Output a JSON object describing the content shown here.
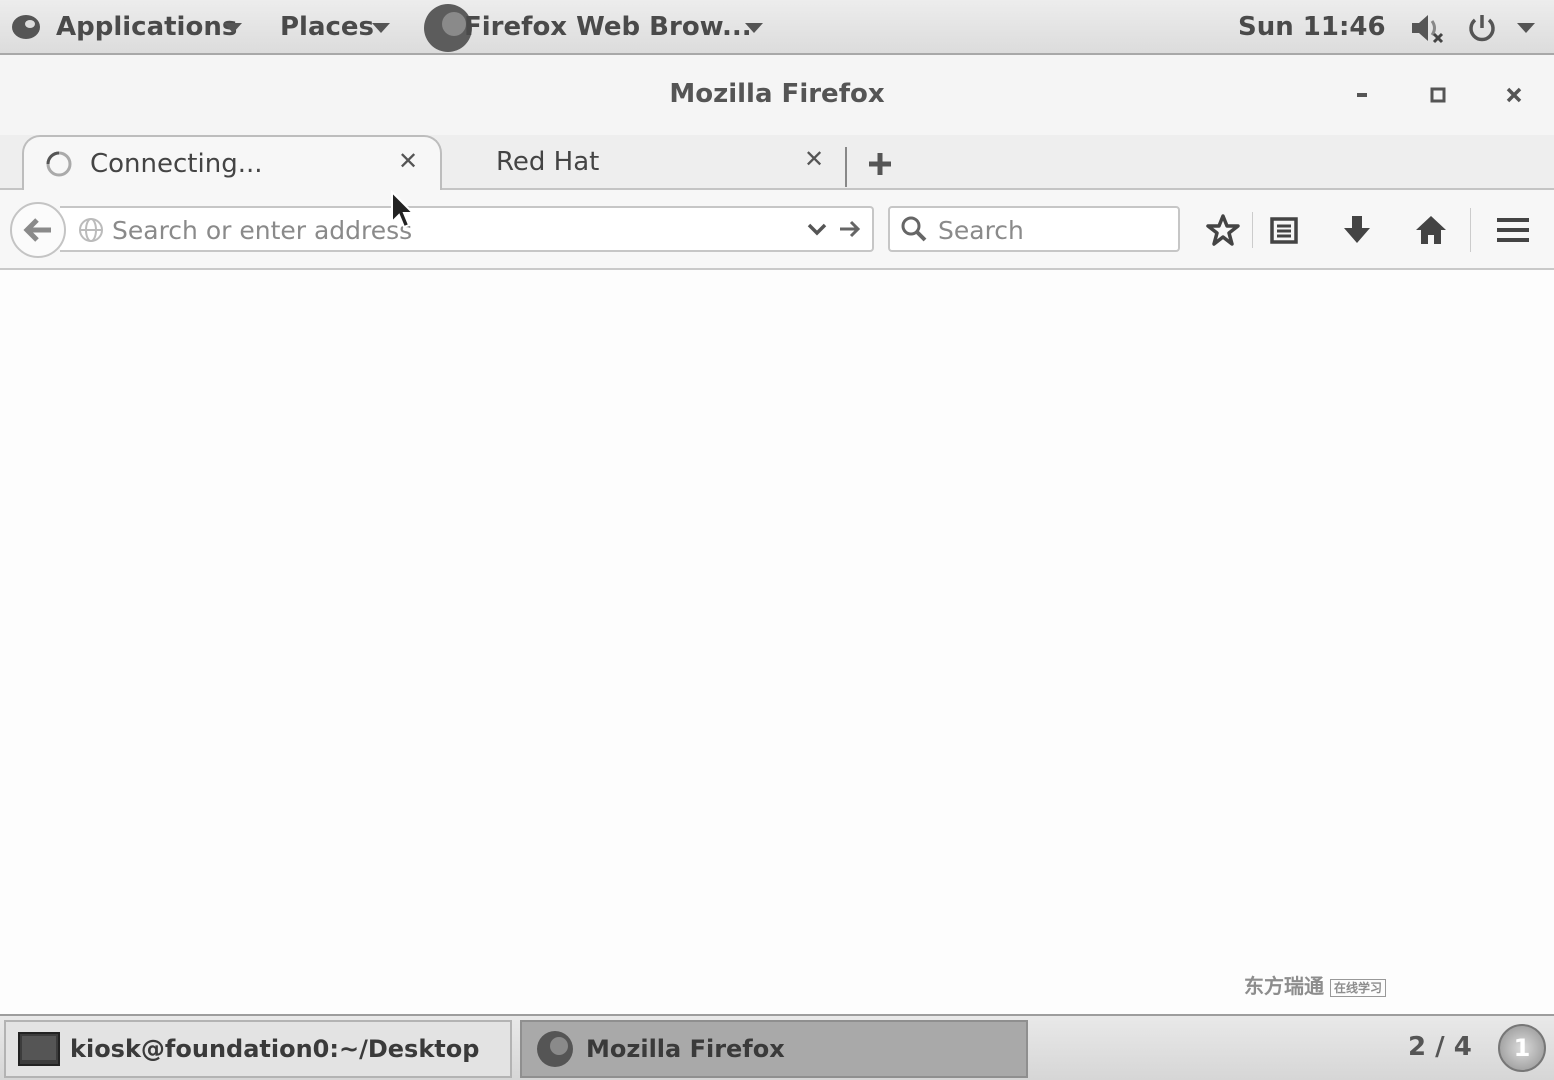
{
  "top_panel": {
    "applications_label": "Applications",
    "places_label": "Places",
    "active_app_label": "Firefox Web Brow...",
    "clock": "Sun 11:46"
  },
  "window": {
    "title": "Mozilla Firefox"
  },
  "tabs": [
    {
      "label": "Connecting...",
      "state": "loading"
    },
    {
      "label": "Red Hat"
    }
  ],
  "navbar": {
    "url_placeholder": "Search or enter address",
    "search_placeholder": "Search"
  },
  "content": {
    "watermark_text": "东方瑞通",
    "watermark_sub": "在线学习"
  },
  "bottom_panel": {
    "tasks": [
      {
        "label": "kiosk@foundation0:~/Desktop"
      },
      {
        "label": "Mozilla Firefox"
      }
    ],
    "workspace": "2 / 4",
    "notification_count": "1"
  }
}
